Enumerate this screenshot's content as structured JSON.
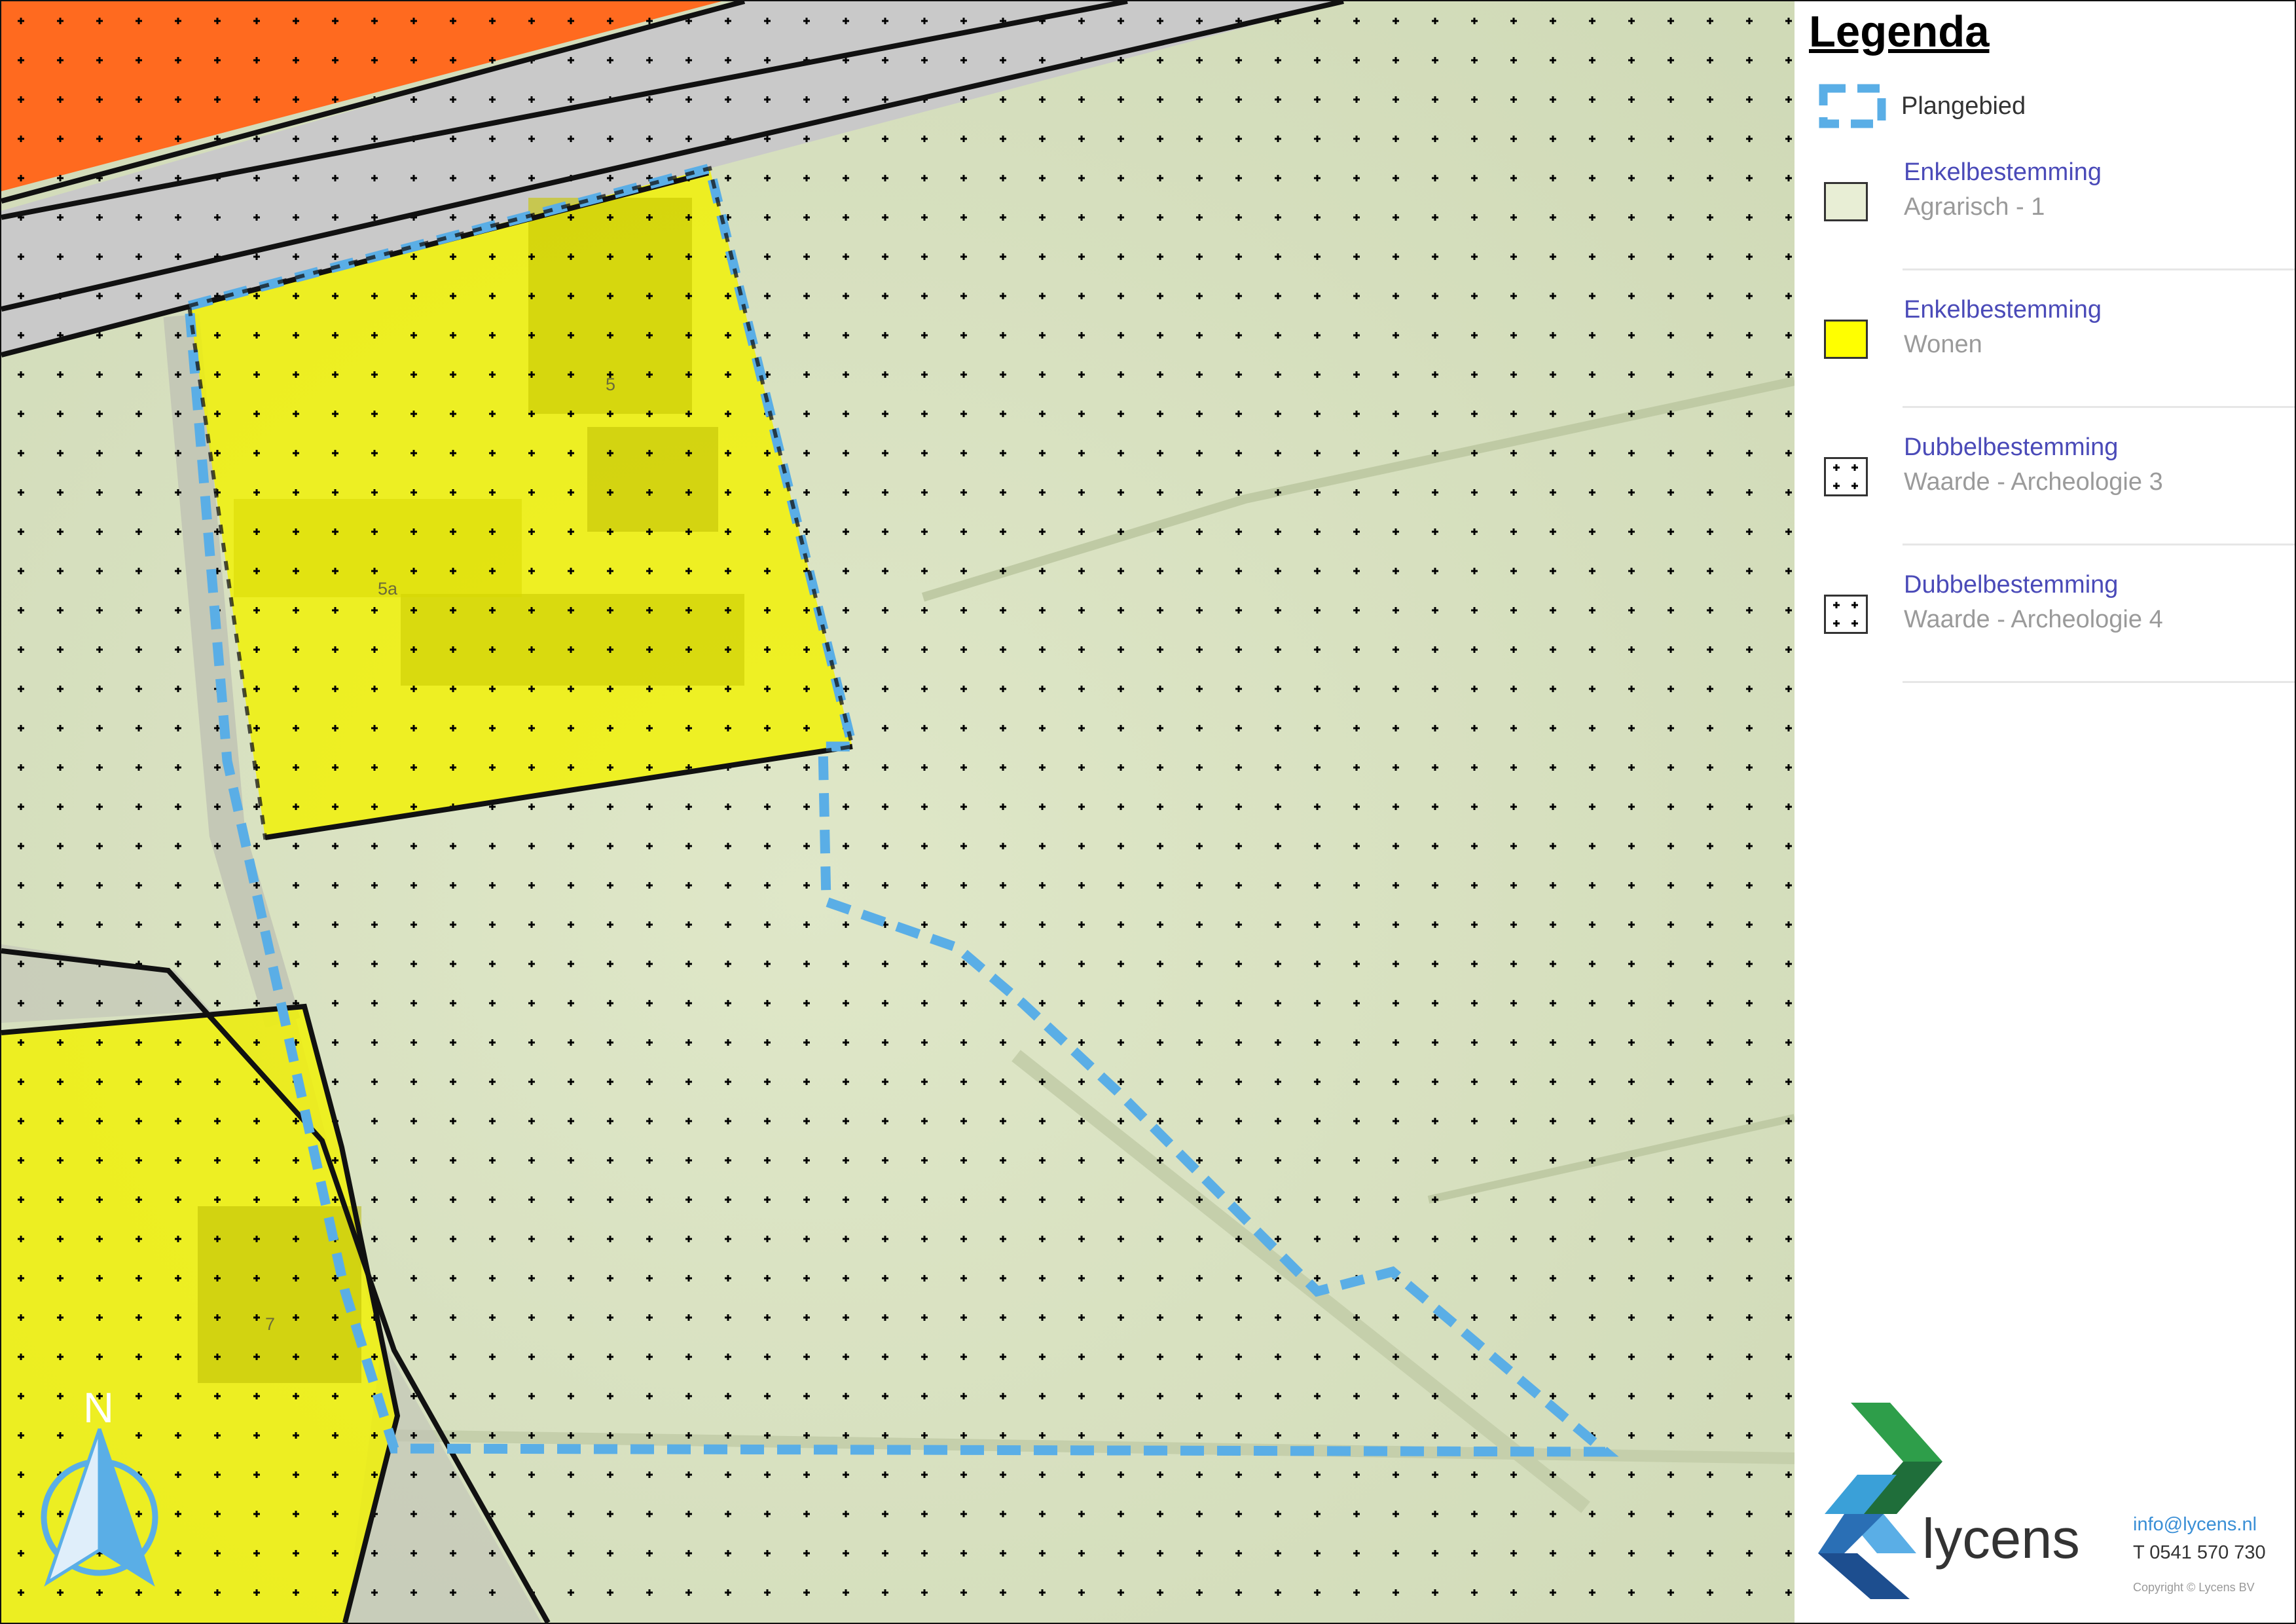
{
  "legend": {
    "title": "Legenda",
    "plangebied_label": "Plangebied",
    "items": [
      {
        "kind": "Enkelbestemming",
        "label": "Agrarisch - 1",
        "swatch_color": "#e8eed5"
      },
      {
        "kind": "Enkelbestemming",
        "label": "Wonen",
        "swatch_color": "#ffff00"
      },
      {
        "kind": "Dubbelbestemming",
        "label": "Waarde - Archeologie 3",
        "swatch_color": "#ffffff"
      },
      {
        "kind": "Dubbelbestemming",
        "label": "Waarde - Archeologie 4",
        "swatch_color": "#ffffff"
      }
    ]
  },
  "map": {
    "lot_numbers": [
      "5",
      "5a",
      "7"
    ],
    "north_label": "N",
    "colors": {
      "plangebied": "#5aaee6",
      "wonen": "#f2f200",
      "agrarisch": "#d7e1c0",
      "bedrijf": "#ff6a1f",
      "road": "#c8c8c8"
    }
  },
  "company": {
    "name": "lycens",
    "email": "info@lycens.nl",
    "phone": "T 0541 570 730",
    "copyright": "Copyright © Lycens BV"
  }
}
